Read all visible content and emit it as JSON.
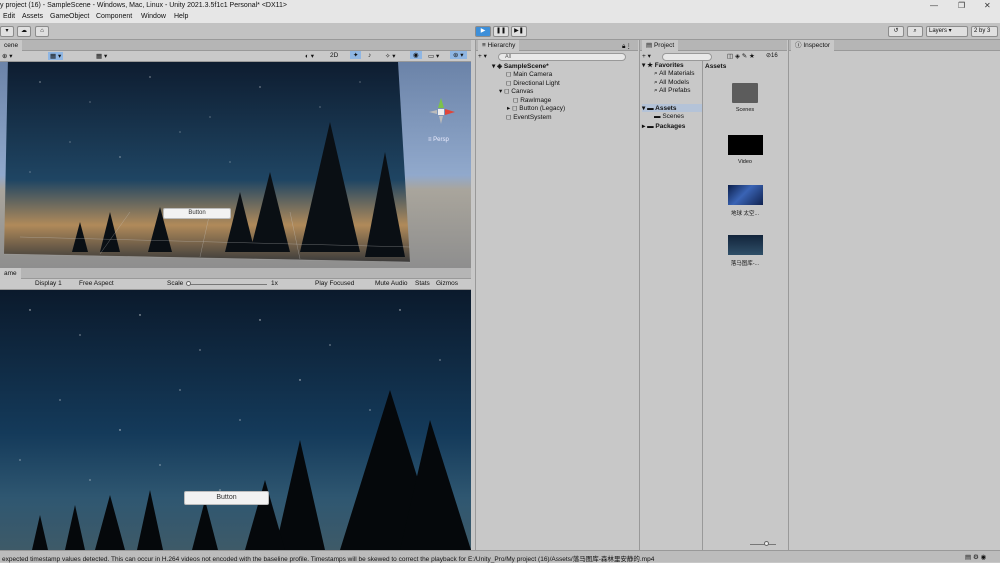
{
  "window": {
    "title": "y project (16) - SampleScene - Windows, Mac, Linux - Unity 2021.3.5f1c1 Personal* <DX11>",
    "minimize": "—",
    "restore": "❐",
    "close": "✕"
  },
  "menu": [
    "Edit",
    "Assets",
    "GameObject",
    "Component",
    "Window",
    "Help"
  ],
  "toolbar": {
    "layers_label": "Layers",
    "layout_label": "2 by 3"
  },
  "scene": {
    "tab_label": "cene",
    "mode_2d": "2D",
    "persp_label": "≡ Persp",
    "button_text": "Button"
  },
  "game": {
    "tab_label": "ame",
    "display": "Display 1",
    "aspect": "Free Aspect",
    "scale_label": "Scale",
    "scale_value": "1x",
    "play_focused": "Play Focused",
    "mute_audio": "Mute Audio",
    "stats": "Stats",
    "gizmos": "Gizmos",
    "button_text": "Button"
  },
  "hierarchy": {
    "tab_label": "Hierarchy",
    "search_placeholder": "All",
    "items": [
      {
        "label": "SampleScene*"
      },
      {
        "label": "Main Camera"
      },
      {
        "label": "Directional Light"
      },
      {
        "label": "Canvas"
      },
      {
        "label": "RawImage"
      },
      {
        "label": "Button (Legacy)"
      },
      {
        "label": "EventSystem"
      }
    ]
  },
  "project": {
    "tab_label": "Project",
    "count": "16",
    "favorites": "Favorites",
    "fav_items": [
      "All Materials",
      "All Models",
      "All Prefabs"
    ],
    "assets": "Assets",
    "scenes": "Scenes",
    "packages": "Packages",
    "assets_header": "Assets",
    "grid": [
      {
        "label": "Scenes",
        "kind": "folder"
      },
      {
        "label": "Video",
        "kind": "black"
      },
      {
        "label": "地球 太空...",
        "kind": "earth"
      },
      {
        "label": "落马图库-...",
        "kind": "night"
      }
    ]
  },
  "inspector": {
    "tab_label": "Inspector"
  },
  "status": {
    "message": "expected timestamp values detected. This can occur in H.264 videos not encoded with the baseline profile. Timestamps will be skewed to correct the playback for E:/Unity_Pro/My project (16)/Assets/落马图库-森林里安静的.mp4"
  }
}
